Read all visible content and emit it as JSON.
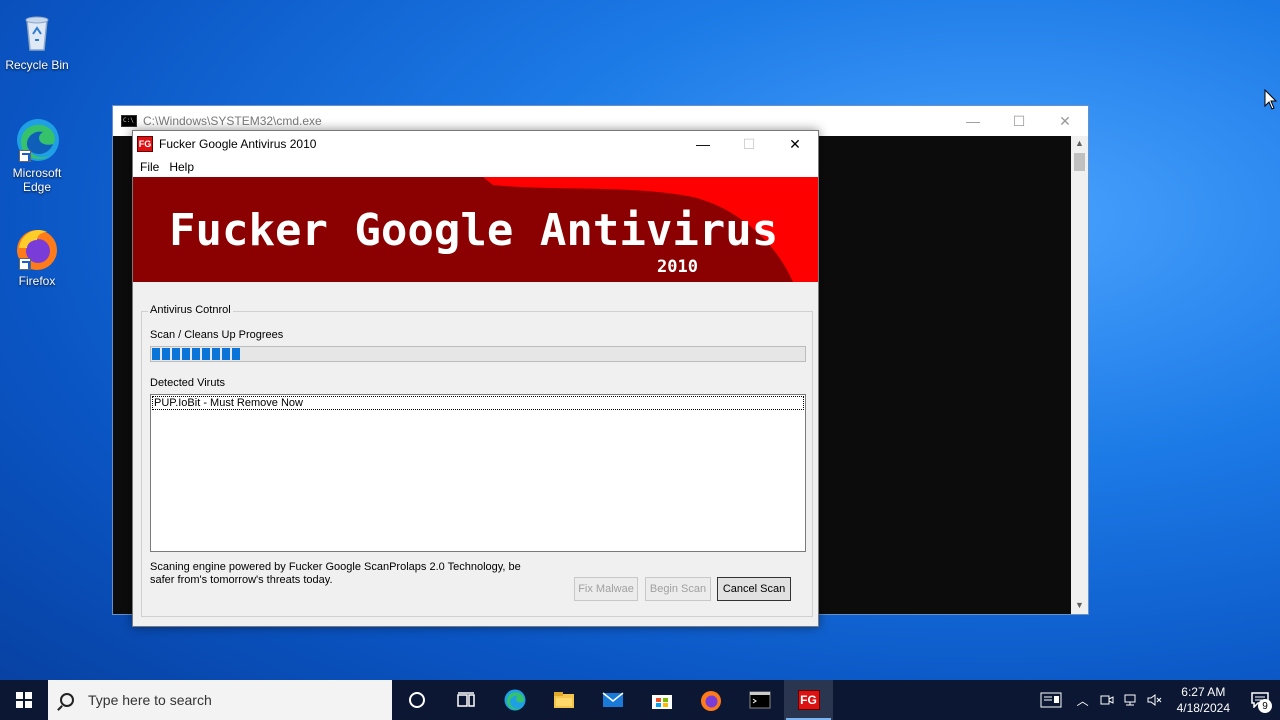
{
  "desktop": {
    "icons": [
      {
        "label": "Recycle Bin",
        "icon": "recycle-bin-icon"
      },
      {
        "label": "Microsoft Edge",
        "icon": "edge-icon"
      },
      {
        "label": "Firefox",
        "icon": "firefox-icon"
      }
    ]
  },
  "cmd_window": {
    "title": "C:\\Windows\\SYSTEM32\\cmd.exe",
    "minimize": "—",
    "maximize": "☐",
    "close": "✕"
  },
  "av_window": {
    "title": "Fucker Google Antivirus 2010",
    "logo_text": "FG",
    "minimize": "—",
    "maximize": "☐",
    "close": "✕",
    "menu": [
      "File",
      "Help"
    ],
    "banner_title": "Fucker Google Antivirus",
    "banner_year": "2010",
    "group_label": "Antivirus Cotnrol",
    "progress_label": "Scan / Cleans Up Progrees",
    "progress_fraction": 0.12,
    "progress_blocks": 9,
    "detected_label": "Detected Viruts",
    "detected_items": [
      "PUP.IoBit - Must Remove Now"
    ],
    "footer_text": "Scaning engine powered by Fucker Google ScanProlaps 2.0 Technology, be safer from's tomorrow's threats today.",
    "buttons": {
      "fix": "Fix Malwae",
      "begin": "Begin Scan",
      "cancel": "Cancel Scan"
    },
    "colors": {
      "banner_dark": "#8b0000",
      "banner_red": "#ff0000",
      "progress": "#0a74d8"
    }
  },
  "taskbar": {
    "search_placeholder": "Type here to search",
    "time": "6:27 AM",
    "date": "4/18/2024",
    "notification_count": "9",
    "pinned": [
      "cortana-icon",
      "task-view-icon",
      "edge-icon",
      "file-explorer-icon",
      "mail-icon",
      "store-icon",
      "firefox-icon",
      "cmd-icon",
      "fg-antivirus-icon"
    ]
  }
}
